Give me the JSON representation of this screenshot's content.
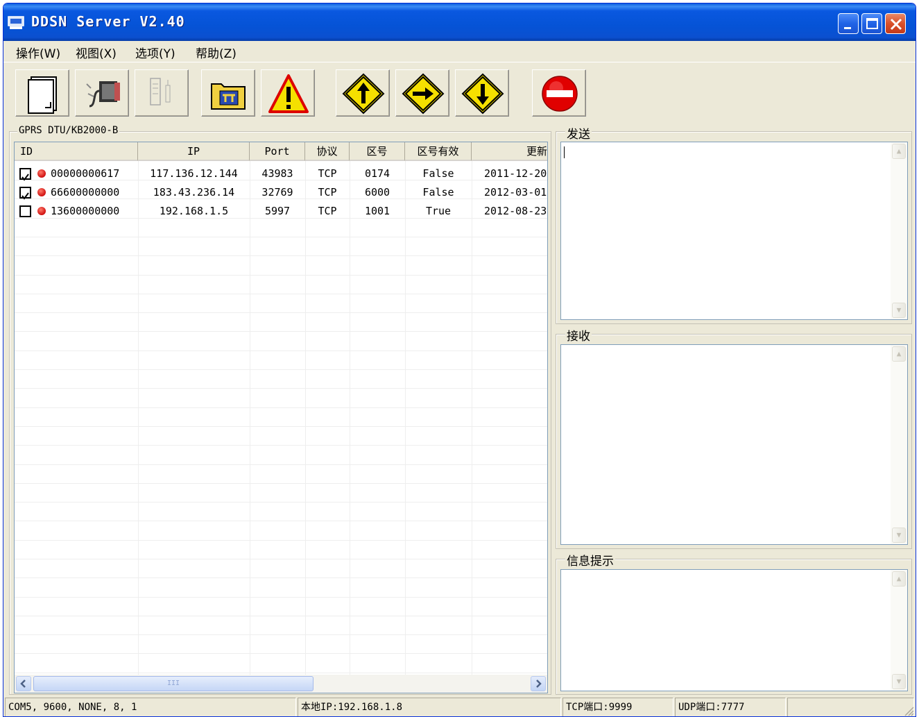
{
  "window": {
    "title": "DDSN Server V2.40"
  },
  "menu": [
    {
      "label": "操作(W)"
    },
    {
      "label": "视图(X)"
    },
    {
      "label": "选项(Y)"
    },
    {
      "label": "帮助(Z)"
    }
  ],
  "toolbar": {
    "buttons": [
      {
        "icon": "document-icon"
      },
      {
        "icon": "serial-port-icon"
      },
      {
        "icon": "device-icon",
        "disabled": true
      },
      {
        "icon": "settings-folder-icon"
      },
      {
        "icon": "warning-icon"
      },
      {
        "icon": "arrow-up-icon"
      },
      {
        "icon": "arrow-right-icon"
      },
      {
        "icon": "arrow-down-icon"
      },
      {
        "icon": "stop-icon"
      }
    ]
  },
  "device_panel": {
    "title": "GPRS DTU/KB2000-B",
    "columns": [
      "ID",
      "IP",
      "Port",
      "协议",
      "区号",
      "区号有效",
      "更新"
    ],
    "rows": [
      {
        "checked": true,
        "id": "00000000617",
        "ip": "117.136.12.144",
        "port": "43983",
        "protocol": "TCP",
        "zone": "0174",
        "zone_valid": "False",
        "updated": "2011-12-20"
      },
      {
        "checked": true,
        "id": "66600000000",
        "ip": "183.43.236.14",
        "port": "32769",
        "protocol": "TCP",
        "zone": "6000",
        "zone_valid": "False",
        "updated": "2012-03-01"
      },
      {
        "checked": false,
        "id": "13600000000",
        "ip": "192.168.1.5",
        "port": "5997",
        "protocol": "TCP",
        "zone": "1001",
        "zone_valid": "True",
        "updated": "2012-08-23"
      }
    ],
    "scroll_thumb_text": "III"
  },
  "send_panel": {
    "title": "发送",
    "content": ""
  },
  "receive_panel": {
    "title": "接收",
    "content": ""
  },
  "info_panel": {
    "title": "信息提示",
    "content": ""
  },
  "statusbar": {
    "serial": "COM5, 9600, NONE, 8, 1",
    "local_ip": "本地IP:192.168.1.8",
    "tcp_port": "TCP端口:9999",
    "udp_port": "UDP端口:7777",
    "extra": ""
  },
  "colors": {
    "titlebar": "#0553d6",
    "window_bg": "#ece9d8",
    "status_error": "#d01010",
    "sign_yellow": "#f5e000",
    "stop_red": "#e00000"
  }
}
